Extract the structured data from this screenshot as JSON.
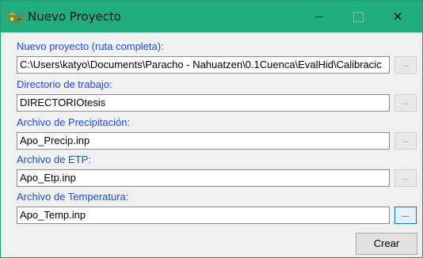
{
  "window": {
    "title": "Nuevo Proyecto",
    "controls": {
      "minimize": "minimize-icon",
      "maximize": "maximize-icon",
      "close": "close-icon"
    },
    "close_glyph": "✕"
  },
  "fields": {
    "project": {
      "label": "Nuevo proyecto (ruta completa):",
      "value": "C:\\Users\\katyo\\Documents\\Paracho - Nahuatzen\\0.1Cuenca\\EvalHid\\Calibracic",
      "browse": "..."
    },
    "workdir": {
      "label": "Directorio de trabajo:",
      "value": "DIRECTORIOtesis",
      "browse": "..."
    },
    "precip": {
      "label": "Archivo de Precipitación:",
      "value": "Apo_Precip.inp",
      "browse": "..."
    },
    "etp": {
      "label": "Archivo de ETP:",
      "value": "Apo_Etp.inp",
      "browse": "..."
    },
    "temp": {
      "label": "Archivo de Temperatura:",
      "value": "Apo_Temp.inp",
      "browse": "..."
    }
  },
  "actions": {
    "create_label": "Crear"
  },
  "colors": {
    "titlebar": "#22ad7e",
    "label": "#1e4fd6",
    "focus": "#0078d7"
  }
}
